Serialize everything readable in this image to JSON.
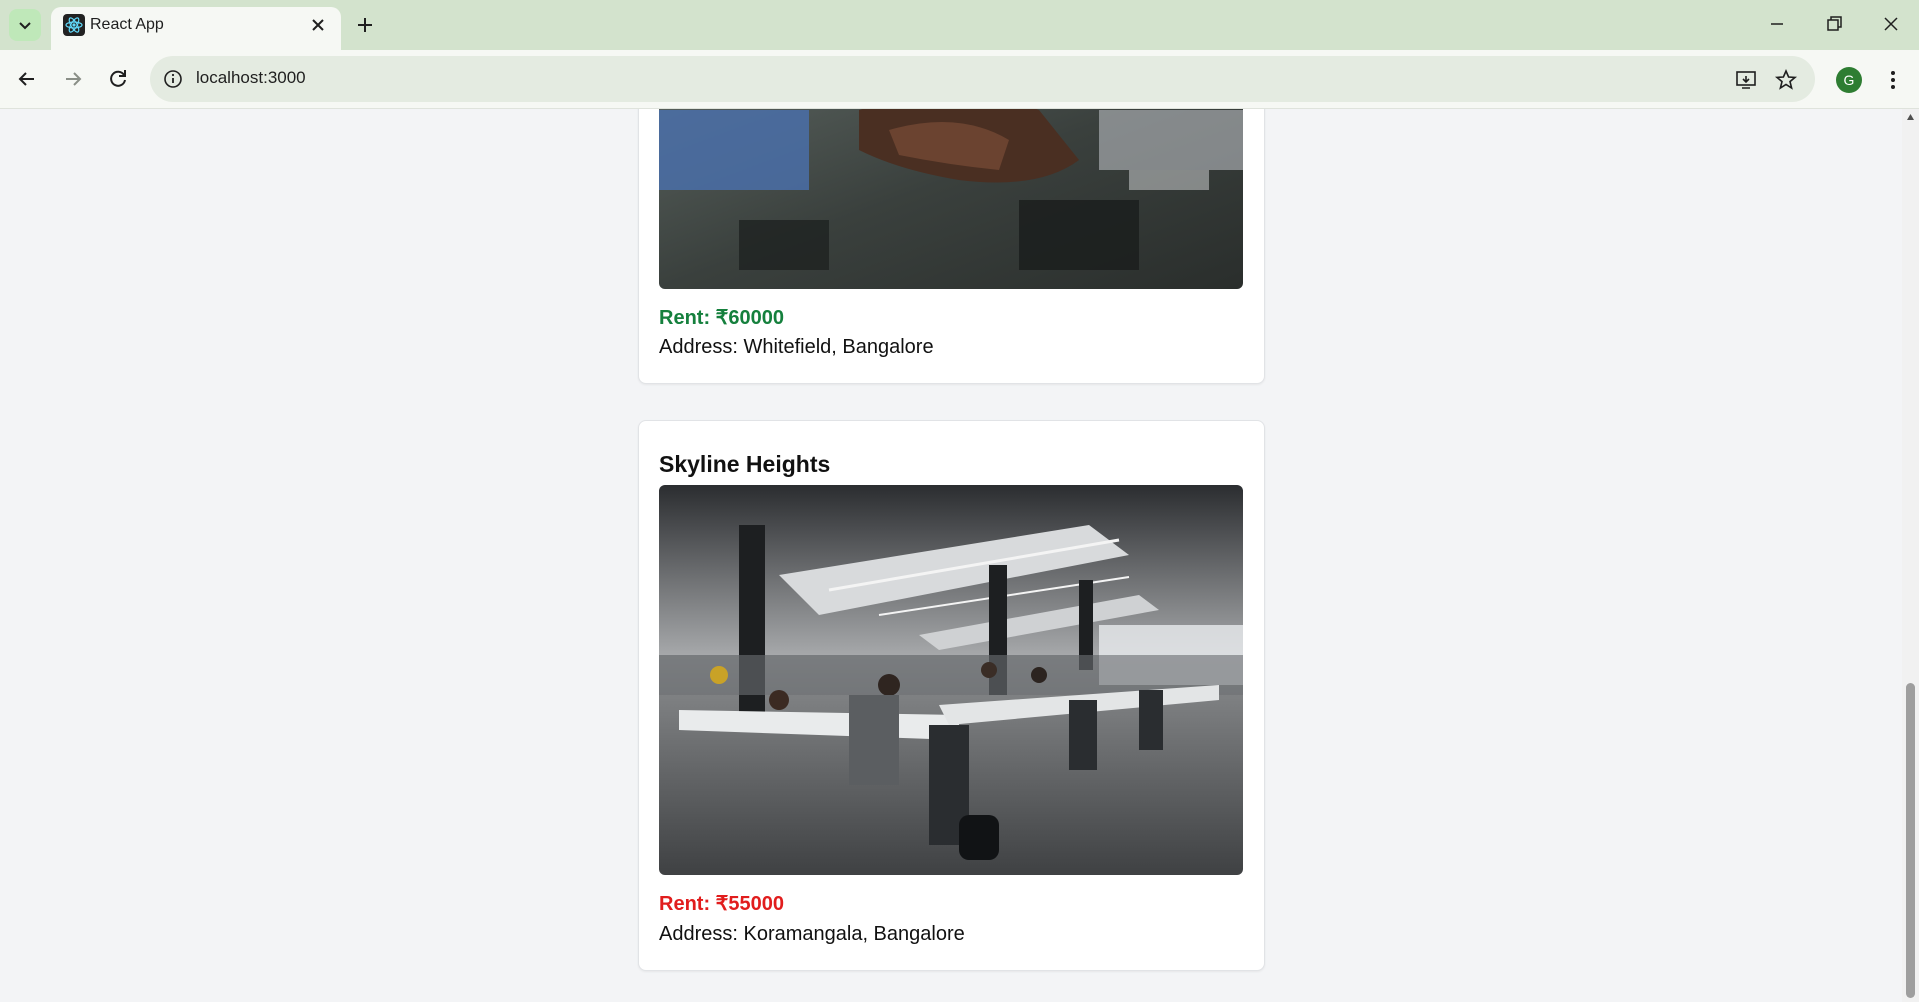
{
  "browser": {
    "tab_title": "React App",
    "url": "localhost:3000",
    "profile_initial": "G"
  },
  "listings": [
    {
      "name": "",
      "rent": "Rent: ₹60000",
      "rent_color": "#15803d",
      "address": "Address: Whitefield, Bangalore",
      "image": "handshake-photo"
    },
    {
      "name": "Skyline Heights",
      "rent": "Rent: ₹55000",
      "rent_color": "#e11d1d",
      "address": "Address: Koramangala, Bangalore",
      "image": "open-office-photo"
    }
  ]
}
